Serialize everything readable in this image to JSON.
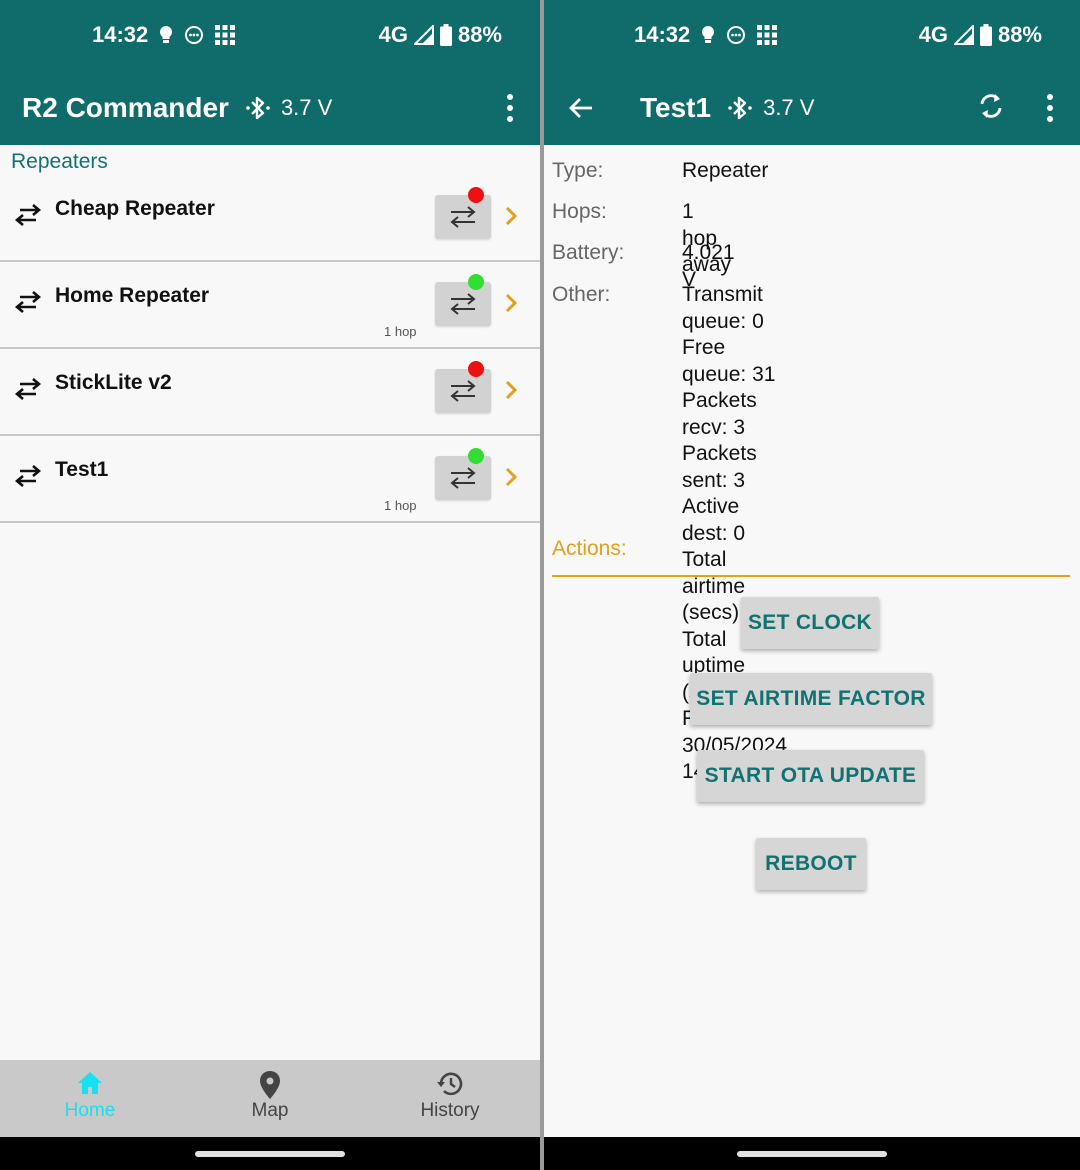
{
  "status": {
    "time": "14:32",
    "network": "4G",
    "battery": "88%"
  },
  "left": {
    "title": "R2 Commander",
    "voltage": "3.7 V",
    "section_title": "Repeaters",
    "repeaters": [
      {
        "name": "Cheap Repeater",
        "hops": "",
        "status_color": "#ee1111"
      },
      {
        "name": "Home Repeater",
        "hops": "1 hop",
        "status_color": "#33dd33"
      },
      {
        "name": "StickLite v2",
        "hops": "",
        "status_color": "#ee1111"
      },
      {
        "name": "Test1",
        "hops": "1 hop",
        "status_color": "#33dd33"
      }
    ],
    "nav": {
      "home": "Home",
      "map": "Map",
      "history": "History"
    }
  },
  "right": {
    "title": "Test1",
    "voltage": "3.7 V",
    "type_label": "Type:",
    "type_value": "Repeater",
    "hops_label": "Hops:",
    "hops_value": "1 hop away",
    "battery_label": "Battery:",
    "battery_value": "4.021 V",
    "other_label": "Other:",
    "other_lines": [
      "Transmit queue: 0",
      "Free queue: 31",
      "Packets recv: 3",
      "Packets sent: 3",
      "Active dest: 0",
      "Total airtime (secs): 0",
      "Total uptime (secs): 18",
      "RTC clock: 30/05/2024 14:32"
    ],
    "actions_title": "Actions:",
    "buttons": {
      "set_clock": "SET CLOCK",
      "set_airtime": "SET AIRTIME FACTOR",
      "start_ota": "START OTA UPDATE",
      "reboot": "REBOOT"
    }
  },
  "colors": {
    "appbar": "#106b6b",
    "accent_teal": "#127272",
    "accent_orange": "#e0a020",
    "nav_active": "#18e0ef"
  }
}
